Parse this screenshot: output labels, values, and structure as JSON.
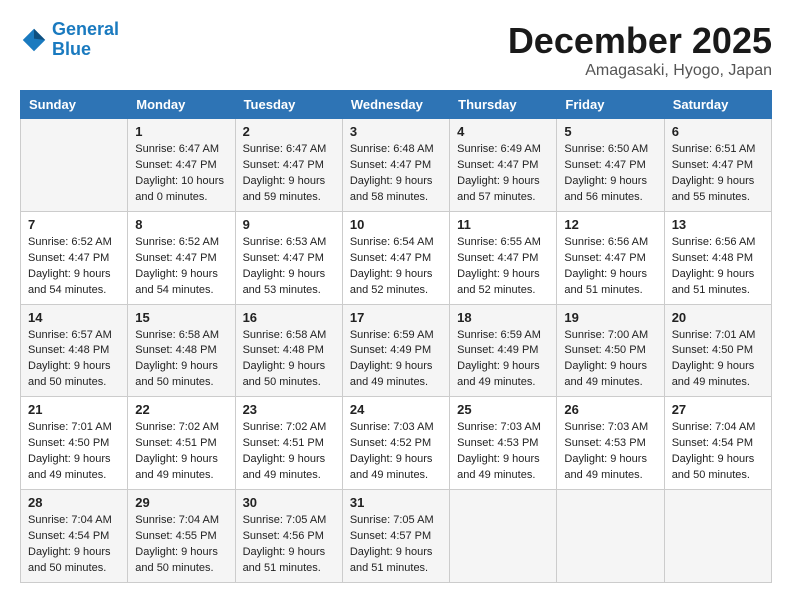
{
  "header": {
    "logo_line1": "General",
    "logo_line2": "Blue",
    "month": "December 2025",
    "location": "Amagasaki, Hyogo, Japan"
  },
  "days_of_week": [
    "Sunday",
    "Monday",
    "Tuesday",
    "Wednesday",
    "Thursday",
    "Friday",
    "Saturday"
  ],
  "weeks": [
    [
      {
        "day": "",
        "content": ""
      },
      {
        "day": "1",
        "content": "Sunrise: 6:47 AM\nSunset: 4:47 PM\nDaylight: 10 hours\nand 0 minutes."
      },
      {
        "day": "2",
        "content": "Sunrise: 6:47 AM\nSunset: 4:47 PM\nDaylight: 9 hours\nand 59 minutes."
      },
      {
        "day": "3",
        "content": "Sunrise: 6:48 AM\nSunset: 4:47 PM\nDaylight: 9 hours\nand 58 minutes."
      },
      {
        "day": "4",
        "content": "Sunrise: 6:49 AM\nSunset: 4:47 PM\nDaylight: 9 hours\nand 57 minutes."
      },
      {
        "day": "5",
        "content": "Sunrise: 6:50 AM\nSunset: 4:47 PM\nDaylight: 9 hours\nand 56 minutes."
      },
      {
        "day": "6",
        "content": "Sunrise: 6:51 AM\nSunset: 4:47 PM\nDaylight: 9 hours\nand 55 minutes."
      }
    ],
    [
      {
        "day": "7",
        "content": "Sunrise: 6:52 AM\nSunset: 4:47 PM\nDaylight: 9 hours\nand 54 minutes."
      },
      {
        "day": "8",
        "content": "Sunrise: 6:52 AM\nSunset: 4:47 PM\nDaylight: 9 hours\nand 54 minutes."
      },
      {
        "day": "9",
        "content": "Sunrise: 6:53 AM\nSunset: 4:47 PM\nDaylight: 9 hours\nand 53 minutes."
      },
      {
        "day": "10",
        "content": "Sunrise: 6:54 AM\nSunset: 4:47 PM\nDaylight: 9 hours\nand 52 minutes."
      },
      {
        "day": "11",
        "content": "Sunrise: 6:55 AM\nSunset: 4:47 PM\nDaylight: 9 hours\nand 52 minutes."
      },
      {
        "day": "12",
        "content": "Sunrise: 6:56 AM\nSunset: 4:47 PM\nDaylight: 9 hours\nand 51 minutes."
      },
      {
        "day": "13",
        "content": "Sunrise: 6:56 AM\nSunset: 4:48 PM\nDaylight: 9 hours\nand 51 minutes."
      }
    ],
    [
      {
        "day": "14",
        "content": "Sunrise: 6:57 AM\nSunset: 4:48 PM\nDaylight: 9 hours\nand 50 minutes."
      },
      {
        "day": "15",
        "content": "Sunrise: 6:58 AM\nSunset: 4:48 PM\nDaylight: 9 hours\nand 50 minutes."
      },
      {
        "day": "16",
        "content": "Sunrise: 6:58 AM\nSunset: 4:48 PM\nDaylight: 9 hours\nand 50 minutes."
      },
      {
        "day": "17",
        "content": "Sunrise: 6:59 AM\nSunset: 4:49 PM\nDaylight: 9 hours\nand 49 minutes."
      },
      {
        "day": "18",
        "content": "Sunrise: 6:59 AM\nSunset: 4:49 PM\nDaylight: 9 hours\nand 49 minutes."
      },
      {
        "day": "19",
        "content": "Sunrise: 7:00 AM\nSunset: 4:50 PM\nDaylight: 9 hours\nand 49 minutes."
      },
      {
        "day": "20",
        "content": "Sunrise: 7:01 AM\nSunset: 4:50 PM\nDaylight: 9 hours\nand 49 minutes."
      }
    ],
    [
      {
        "day": "21",
        "content": "Sunrise: 7:01 AM\nSunset: 4:50 PM\nDaylight: 9 hours\nand 49 minutes."
      },
      {
        "day": "22",
        "content": "Sunrise: 7:02 AM\nSunset: 4:51 PM\nDaylight: 9 hours\nand 49 minutes."
      },
      {
        "day": "23",
        "content": "Sunrise: 7:02 AM\nSunset: 4:51 PM\nDaylight: 9 hours\nand 49 minutes."
      },
      {
        "day": "24",
        "content": "Sunrise: 7:03 AM\nSunset: 4:52 PM\nDaylight: 9 hours\nand 49 minutes."
      },
      {
        "day": "25",
        "content": "Sunrise: 7:03 AM\nSunset: 4:53 PM\nDaylight: 9 hours\nand 49 minutes."
      },
      {
        "day": "26",
        "content": "Sunrise: 7:03 AM\nSunset: 4:53 PM\nDaylight: 9 hours\nand 49 minutes."
      },
      {
        "day": "27",
        "content": "Sunrise: 7:04 AM\nSunset: 4:54 PM\nDaylight: 9 hours\nand 50 minutes."
      }
    ],
    [
      {
        "day": "28",
        "content": "Sunrise: 7:04 AM\nSunset: 4:54 PM\nDaylight: 9 hours\nand 50 minutes."
      },
      {
        "day": "29",
        "content": "Sunrise: 7:04 AM\nSunset: 4:55 PM\nDaylight: 9 hours\nand 50 minutes."
      },
      {
        "day": "30",
        "content": "Sunrise: 7:05 AM\nSunset: 4:56 PM\nDaylight: 9 hours\nand 51 minutes."
      },
      {
        "day": "31",
        "content": "Sunrise: 7:05 AM\nSunset: 4:57 PM\nDaylight: 9 hours\nand 51 minutes."
      },
      {
        "day": "",
        "content": ""
      },
      {
        "day": "",
        "content": ""
      },
      {
        "day": "",
        "content": ""
      }
    ]
  ]
}
